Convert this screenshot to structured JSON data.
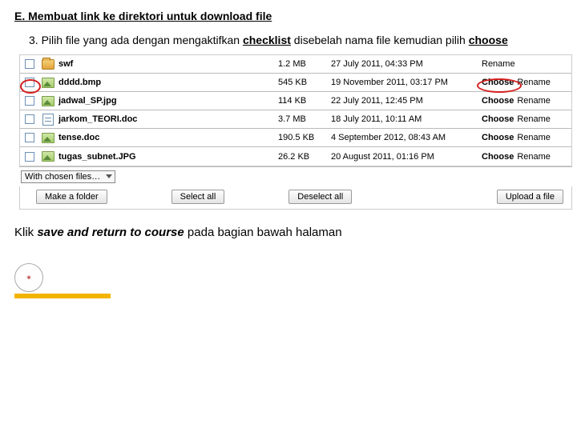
{
  "heading": "E.  Membuat link ke direktori untuk download file",
  "step_prefix": "3.  Pilih file yang ada dengan mengaktifkan ",
  "step_kw1": "checklist",
  "step_mid": " disebelah nama file kemudian pilih ",
  "step_kw2": "choose",
  "files": [
    {
      "icon": "folder",
      "name": "swf",
      "size": "1.2 MB",
      "date": "27 July 2011, 04:33 PM",
      "choose": false
    },
    {
      "icon": "image",
      "name": "dddd.bmp",
      "size": "545 KB",
      "date": "19 November 2011, 03:17 PM",
      "choose": true,
      "hl_cb": true,
      "hl_choose": true
    },
    {
      "icon": "image",
      "name": "jadwal_SP.jpg",
      "size": "114 KB",
      "date": "22 July 2011, 12:45 PM",
      "choose": true
    },
    {
      "icon": "doc",
      "name": "jarkom_TEORI.doc",
      "size": "3.7 MB",
      "date": "18 July 2011, 10:11 AM",
      "choose": true
    },
    {
      "icon": "image",
      "name": "tense.doc",
      "size": "190.5 KB",
      "date": "4 September 2012, 08:43 AM",
      "choose": true
    },
    {
      "icon": "image",
      "name": "tugas_subnet.JPG",
      "size": "26.2 KB",
      "date": "20 August 2011, 01:16 PM",
      "choose": true
    }
  ],
  "labels": {
    "choose": "Choose",
    "rename": "Rename",
    "with_chosen": "With chosen files…",
    "make_folder": "Make a folder",
    "select_all": "Select all",
    "deselect_all": "Deselect all",
    "upload": "Upload a file"
  },
  "footer_prefix": "Klik ",
  "footer_italic": "save and return to course",
  "footer_suffix": " pada bagian bawah halaman",
  "logo_text": "✶"
}
